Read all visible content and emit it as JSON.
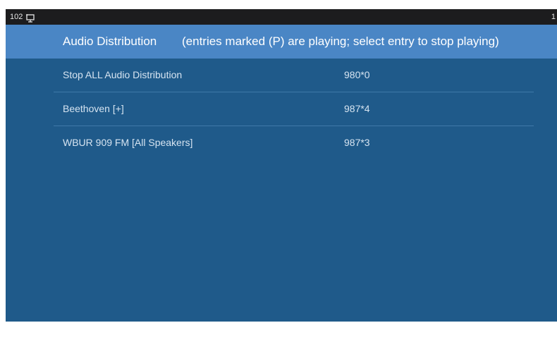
{
  "status_bar": {
    "extension": "102",
    "icon": "phone-screen-icon",
    "time_fragment": "1"
  },
  "header": {
    "title": "Audio Distribution",
    "hint": "(entries marked (P) are playing; select entry to stop playing)"
  },
  "entries": [
    {
      "name": "Stop ALL Audio Distribution",
      "code": "980*0"
    },
    {
      "name": "Beethoven [+]",
      "code": "987*4"
    },
    {
      "name": "WBUR 909 FM [All Speakers]",
      "code": "987*3"
    }
  ],
  "colors": {
    "screen_background": "#1f5a8a",
    "title_bar": "#4a86c5",
    "status_bar": "#1c1c1e",
    "row_divider": "#3f79a8",
    "row_text": "#d6e4f1"
  }
}
